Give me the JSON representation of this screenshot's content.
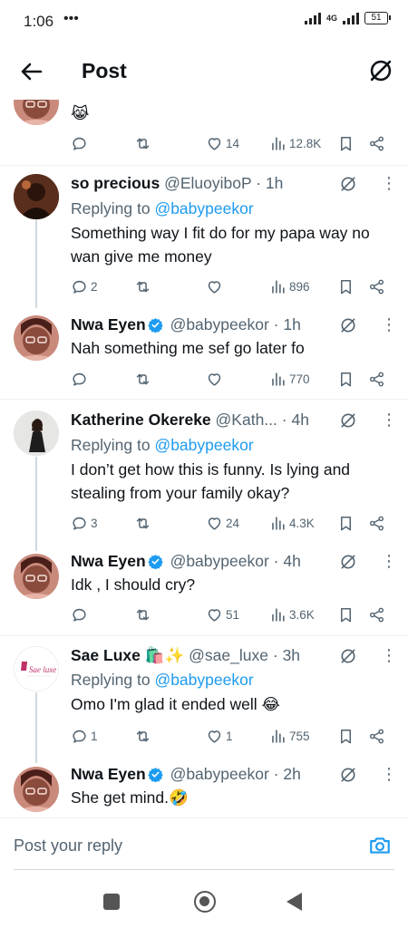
{
  "status_bar": {
    "time": "1:06",
    "dots": "•••",
    "network": "4G",
    "battery": "51"
  },
  "header": {
    "title": "Post"
  },
  "partial_tweet": {
    "emoji": "😹",
    "stats": {
      "replies": "",
      "likes": "14",
      "views": "12.8K"
    }
  },
  "replies": [
    {
      "name": "so precious",
      "handle": "@EluoyiboP",
      "time": "· 1h",
      "verified": false,
      "replying_label": "Replying to",
      "replying_to": "@babypeekor",
      "text": "Something way I fit do for my papa way no wan give me money",
      "stats": {
        "replies": "2",
        "likes": "",
        "views": "896"
      }
    },
    {
      "name": "Nwa Eyen",
      "handle": "@babypeekor",
      "time": "· 1h",
      "verified": true,
      "text": "Nah something me sef go later fo",
      "stats": {
        "replies": "",
        "likes": "",
        "views": "770"
      }
    },
    {
      "name": "Katherine Okereke",
      "handle": "@Kath...",
      "time": "· 4h",
      "verified": false,
      "replying_label": "Replying to",
      "replying_to": "@babypeekor",
      "text": "I don’t get how this is funny. Is lying and stealing from your family okay?",
      "stats": {
        "replies": "3",
        "likes": "24",
        "views": "4.3K"
      }
    },
    {
      "name": "Nwa Eyen",
      "handle": "@babypeekor",
      "time": "· 4h",
      "verified": true,
      "text": "Idk , I should cry?",
      "stats": {
        "replies": "",
        "likes": "51",
        "views": "3.6K"
      }
    },
    {
      "name": "Sae Luxe 🛍️✨",
      "handle": "@sae_luxe",
      "time": "· 3h",
      "verified": false,
      "replying_label": "Replying to",
      "replying_to": "@babypeekor",
      "text": "Omo I'm glad it ended well 😂",
      "stats": {
        "replies": "1",
        "likes": "1",
        "views": "755"
      },
      "avatar_logo_text": "Sae luxe"
    },
    {
      "name": "Nwa Eyen",
      "handle": "@babypeekor",
      "time": "· 2h",
      "verified": true,
      "text": "She get mind.🤣"
    }
  ],
  "reply_bar": {
    "placeholder": "Post your reply"
  },
  "colors": {
    "accent": "#1d9bf0",
    "text": "#0f1419",
    "muted": "#536471",
    "divider": "#eff3f4"
  },
  "icons": [
    "arrow-left-icon",
    "grok-icon",
    "comment-icon",
    "retweet-icon",
    "heart-icon",
    "views-icon",
    "bookmark-icon",
    "share-icon",
    "more-icon",
    "verified-icon",
    "camera-icon"
  ]
}
